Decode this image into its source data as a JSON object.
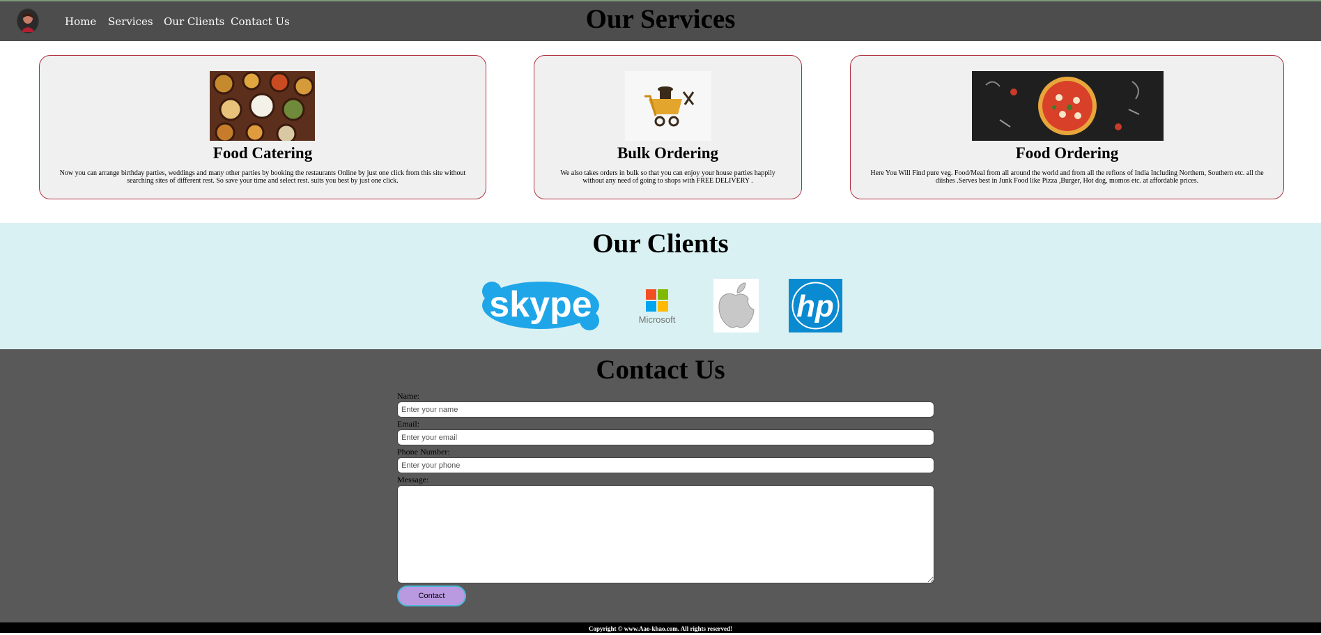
{
  "nav": {
    "items": [
      "Home",
      "Services",
      "Our Clients",
      "Contact Us"
    ]
  },
  "services": {
    "title": "Our Services",
    "cards": [
      {
        "title": "Food Catering",
        "description": "Now you can arrange birthday parties, weddings and many other parties by booking the restaurants Online by just one click from this site without searching sites of different rest. So save your time and select rest. suits you best by just one click."
      },
      {
        "title": "Bulk Ordering",
        "description": "We also takes orders in bulk so that you can enjoy your house parties happily without any need of going to shops with FREE DELIVERY ."
      },
      {
        "title": "Food Ordering",
        "description": "Here You Will Find pure veg. Food/Meal from all around the world and from all the refions of India Including Northern, Southern etc. all the diishes .Serves best in Junk Food like Pizza ,Burger, Hot dog, momos etc. at affordable prices."
      }
    ]
  },
  "clients": {
    "title": "Our Clients",
    "logos": [
      "skype",
      "Microsoft",
      "apple",
      "hp"
    ]
  },
  "contact": {
    "title": "Contact Us",
    "name_label": "Name:",
    "name_placeholder": "Enter your name",
    "email_label": "Email:",
    "email_placeholder": "Enter your email",
    "phone_label": "Phone Number:",
    "phone_placeholder": "Enter your phone",
    "message_label": "Message:",
    "button_label": "Contact"
  },
  "footer": {
    "text": "Copyright © www.Aao-khao.com. All rights reserved!"
  },
  "colors": {
    "nav_bg": "#4d4d4d",
    "card_border": "#b03040",
    "clients_bg": "#daf1f3",
    "contact_bg": "#595959",
    "button_bg": "#b99ae0"
  }
}
